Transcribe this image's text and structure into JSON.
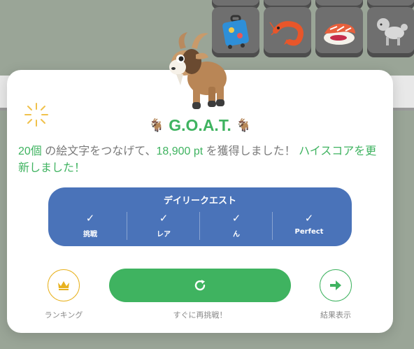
{
  "background": {
    "tiles": [
      {
        "icon": "suitcase-icon"
      },
      {
        "icon": "shrimp-icon"
      },
      {
        "icon": "sushi-icon"
      },
      {
        "icon": "poodle-icon"
      }
    ]
  },
  "dialog": {
    "title": "G.O.A.T.",
    "title_emoji": "🐐",
    "message": {
      "count": "20個",
      "part1": " の絵文字をつなげて、",
      "points": "18,900 pt",
      "part2": " を獲得しました！ ",
      "highscore": "ハイスコアを更新しました！"
    },
    "daily_quest": {
      "title": "デイリークエスト",
      "items": [
        {
          "check": "✓",
          "label": "挑戦"
        },
        {
          "check": "✓",
          "label": "レア"
        },
        {
          "check": "✓",
          "label": "ん"
        },
        {
          "check": "✓",
          "label": "Perfect"
        }
      ]
    },
    "buttons": {
      "ranking_label": "ランキング",
      "retry_label": "すぐに再挑戦！",
      "results_label": "結果表示"
    }
  },
  "colors": {
    "accent_green": "#3fb360",
    "quest_blue": "#4a73b9",
    "gold": "#e8b21f"
  }
}
